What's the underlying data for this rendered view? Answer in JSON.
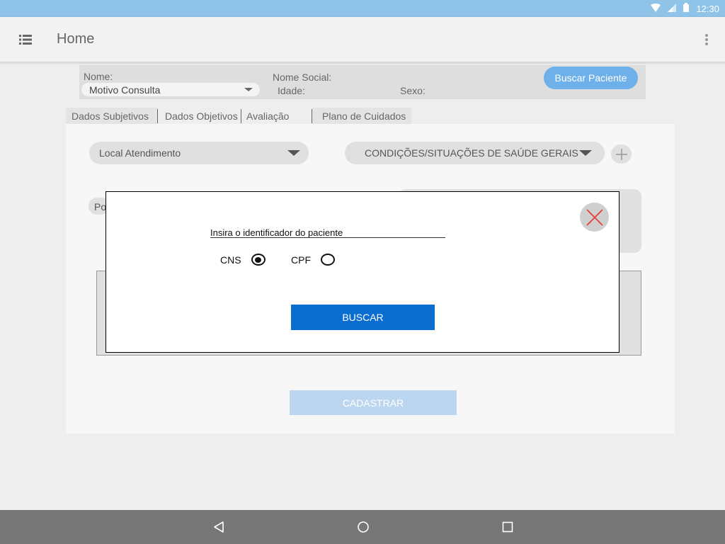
{
  "status_bar": {
    "time": "12:30",
    "icons": [
      "wifi-icon",
      "signal-icon",
      "battery-icon"
    ]
  },
  "app_bar": {
    "title": "Home",
    "menu_icon": "list-menu-icon",
    "overflow_icon": "more-vert-icon"
  },
  "patient": {
    "nome_label": "Nome:",
    "nome_social_label": "Nome Social:",
    "idade_label": "Idade:",
    "sexo_label": "Sexo:",
    "motivo_select": "Motivo Consulta",
    "buscar_paciente_label": "Buscar Paciente"
  },
  "tabs": [
    {
      "label": "Dados Subjetivos",
      "active": true
    },
    {
      "label": "Dados Objetivos",
      "active": false
    },
    {
      "label": "Avaliação",
      "active": false
    },
    {
      "label": "Plano de Cuidados",
      "active": false
    }
  ],
  "form": {
    "local_atendimento": "Local Atendimento",
    "condicoes": "CONDIÇÕES/SITUAÇÕES DE SAÚDE GERAIS",
    "chip_po": "Po",
    "cadastrar_label": "CADASTRAR"
  },
  "modal": {
    "prompt": "Insira o identificador do paciente",
    "options": [
      {
        "label": "CNS",
        "selected": true
      },
      {
        "label": "CPF",
        "selected": false
      }
    ],
    "buscar_label": "BUSCAR",
    "close_icon": "close-x-icon"
  },
  "nav_bar": {
    "icons": [
      "back-icon",
      "home-icon",
      "recents-icon"
    ]
  },
  "colors": {
    "status_bar": "#8fc3e8",
    "primary_button": "#0a6ed1",
    "pill_button": "#6db0ea",
    "disabled_button": "#bcd6f0",
    "close_x": "#e53935"
  }
}
